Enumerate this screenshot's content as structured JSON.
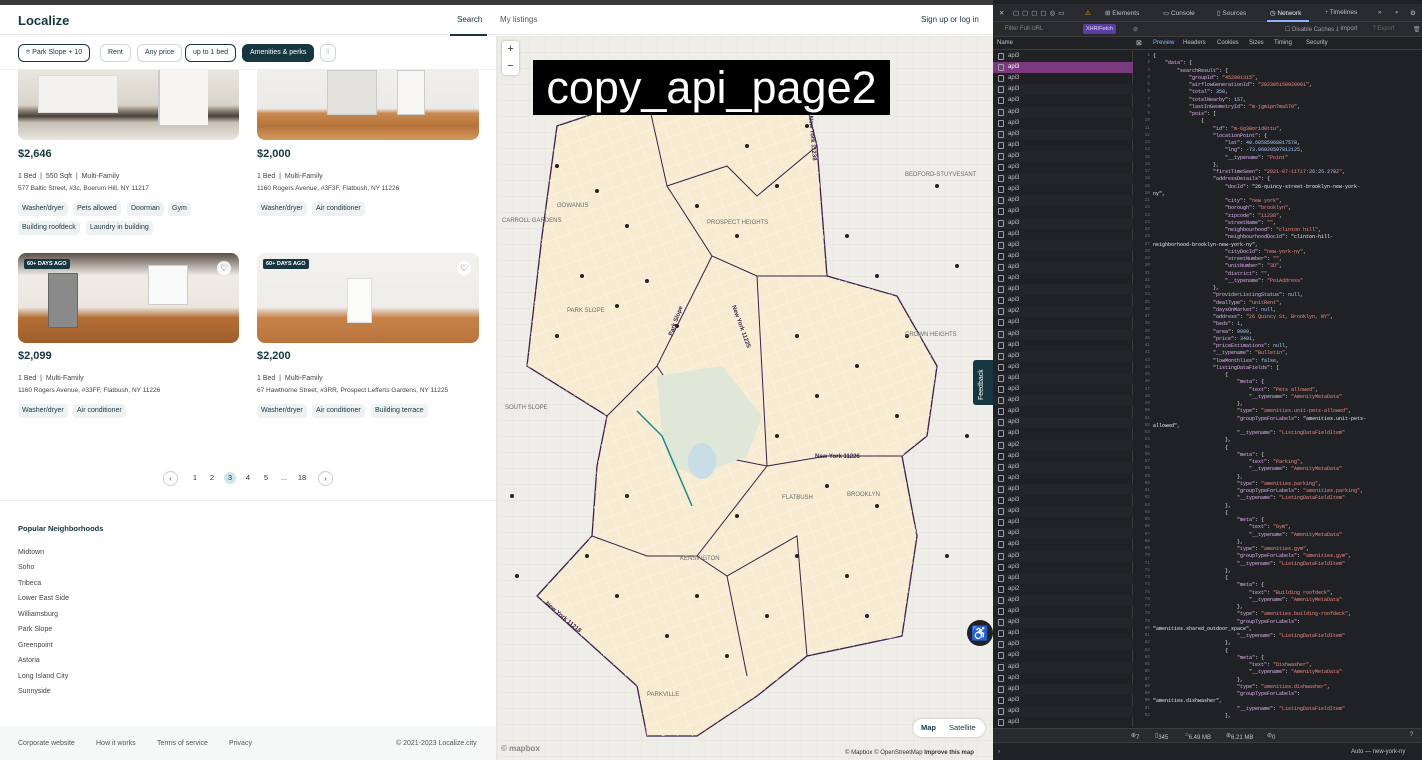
{
  "header": {
    "logo": "Localize",
    "nav_search": "Search",
    "nav_my_listings": "My listings",
    "signup": "Sign up or log in"
  },
  "filters": {
    "location": "Park Slope + 10",
    "deal": "Rent",
    "price": "Any price",
    "beds": "up to 1 bed",
    "amenities": "Amenities & perks",
    "more_icon": "sliders-icon"
  },
  "listings": [
    {
      "price": "$2,646",
      "beds": "1 Bed",
      "sqft": "550 Sqft",
      "type": "Multi-Family",
      "address": "577 Baltic Street, #3c, Boerum Hill, NY 11217",
      "tags": [
        "Washer/dryer",
        "Pets allowed",
        "Doorman",
        "Gym",
        "Building roofdeck",
        "Laundry in building"
      ]
    },
    {
      "price": "$2,000",
      "beds": "1 Bed",
      "type": "Multi-Family",
      "address": "1160 Rogers Avenue, #3F3F, Flatbush, NY 11226",
      "tags": [
        "Washer/dryer",
        "Air conditioner"
      ]
    },
    {
      "badge": "60+ DAYS AGO",
      "price": "$2,099",
      "beds": "1 Bed",
      "type": "Multi-Family",
      "address": "1160 Rogers Avenue, #33FF, Flatbush, NY 11226",
      "tags": [
        "Washer/dryer",
        "Air conditioner"
      ]
    },
    {
      "badge": "60+ DAYS AGO",
      "price": "$2,200",
      "beds": "1 Bed",
      "type": "Multi-Family",
      "address": "67 Hawthorne Street, #3RR, Prospect Lefferts Gardens, NY 11225",
      "tags": [
        "Washer/dryer",
        "Air conditioner",
        "Building terrace"
      ]
    }
  ],
  "pagination": {
    "prev": "‹",
    "pages": [
      "1",
      "2",
      "3",
      "4",
      "5",
      "...",
      "18"
    ],
    "current": "3",
    "next": "›"
  },
  "popular": {
    "title": "Popular Neighborhoods",
    "items": [
      "Midtown",
      "Soho",
      "Tribeca",
      "Lower East Side",
      "Williamsburg",
      "Park Slope",
      "Greenpoint",
      "Astoria",
      "Long Island City",
      "Sunnyside"
    ]
  },
  "footer": {
    "links": [
      "Corporate website",
      "How it works",
      "Terms of service",
      "Privacy"
    ],
    "copyright": "© 2021-2023 Localize.city"
  },
  "map": {
    "zoom_in": "+",
    "zoom_out": "−",
    "overlay_label": "copy_api_page2",
    "feedback": "Feedback",
    "toggle_map": "Map",
    "toggle_satellite": "Satellite",
    "mapbox": "© mapbox",
    "attribution": "© Mapbox © OpenStreetMap",
    "improve": "Improve this map",
    "labels": [
      "GOWANUS",
      "CARROLL GARDENS",
      "PROSPECT HEIGHTS",
      "PARK SLOPE",
      "CROWN HEIGHTS",
      "BEDFORD-STUYVESANT",
      "SOUTH SLOPE",
      "FLATBUSH",
      "BROOKLYN",
      "KENSINGTON",
      "PARKVILLE",
      "New York 11226",
      "New York 11238",
      "New York 11225",
      "Park Slope",
      "New York 11218"
    ]
  },
  "devtools": {
    "tabs": [
      "Elements",
      "Console",
      "Sources",
      "Network",
      "Timelines"
    ],
    "active_tab": "Network",
    "filter_placeholder": "Filter Full URL",
    "xhr_chip": "XHR/Fetch",
    "disable_caches": "Disable Caches",
    "import": "Import",
    "export": "Export",
    "name_col": "Name",
    "subtabs": [
      "Preview",
      "Headers",
      "Cookies",
      "Sizes",
      "Timing",
      "Security"
    ],
    "active_subtab": "Preview",
    "requests": [
      "api3",
      "api3",
      "api3",
      "api3",
      "api3",
      "api3",
      "api3",
      "api3",
      "api3",
      "api3",
      "api3",
      "api3",
      "api3",
      "api3",
      "api3",
      "api3",
      "api3",
      "api3",
      "api3",
      "api3",
      "api3",
      "api3",
      "api3",
      "api2",
      "api3",
      "api3",
      "api3",
      "api3",
      "api3",
      "api3",
      "api3",
      "api3",
      "api3",
      "api3",
      "api3",
      "api2",
      "api3",
      "api3",
      "api3",
      "api3",
      "api3",
      "api3",
      "api3",
      "api3",
      "api3",
      "api3",
      "api3",
      "api3",
      "api2",
      "api3",
      "api3",
      "api3",
      "api3",
      "api3",
      "api3",
      "api3",
      "api3",
      "api3",
      "api3",
      "api3",
      "api3"
    ],
    "selected_index": 1,
    "status": {
      "requests": "7",
      "resources": "345",
      "size": "6.49 MB",
      "transferred": "6.21 MB",
      "time": "0"
    },
    "bottom_right": "Auto — new-york-ny"
  },
  "json_lines": [
    "{",
    "    \"data\": {",
    "        \"searchResult\": {",
    "            \"groupId\": \"452001315\",",
    "            \"airflowGenerationId\": \"202305150920001\",",
    "            \"total\": 350,",
    "            \"totalNearby\": 157,",
    "            \"lastInGeometryId\": \"m-jgmipn7ma570\",",
    "            \"pois\": [",
    "                {",
    "                    \"id\": \"m-6g30orid0ttu\",",
    "                    \"locationPoint\": {",
    "                        \"lat\": 40.68585968017578,",
    "                        \"lng\": -73.96020507812125,",
    "                        \"__typename\": \"Point\"",
    "                    },",
    "                    \"firstTimeSeen\": \"2021-07-11T17:26:25.270Z\",",
    "                    \"addressDetails\": {",
    "                        \"docId\": \"26-quincy-street-brooklyn-new-york-",
    "ny\",",
    "                        \"city\": \"new york\",",
    "                        \"borough\": \"brooklyn\",",
    "                        \"zipcode\": \"11238\",",
    "                        \"streetName\": \"\",",
    "                        \"neighbourhood\": \"clinton hill\",",
    "                        \"neighbourhoodDocId\": \"clinton-hill-",
    "neighborhood-brooklyn-new-york-ny\",",
    "                        \"cityDocId\": \"new-york-ny\",",
    "                        \"streetNumber\": \"\",",
    "                        \"unitNumber\": \"3D\",",
    "                        \"district\": \"\",",
    "                        \"__typename\": \"PoiAddress\"",
    "                    },",
    "                    \"providerListingStatus\": null,",
    "                    \"dealType\": \"unitRent\",",
    "                    \"daysOnMarket\": null,",
    "                    \"address\": \"26 Quincy St, Brooklyn, NY\",",
    "                    \"beds\": 1,",
    "                    \"area\": 9999,",
    "                    \"price\": 3491,",
    "                    \"priceEstimations\": null,",
    "                    \"__typename\": \"Bulletin\",",
    "                    \"lowMonthlies\": false,",
    "                    \"listingDataFields\": [",
    "                        {",
    "                            \"meta\": {",
    "                                \"text\": \"Pets allowed\",",
    "                                \"__typename\": \"AmenityMetaData\"",
    "                            },",
    "                            \"type\": \"amenities.unit-pets-allowed\",",
    "                            \"groupTypeForLabels\": \"amenities.unit-pets-",
    "allowed\",",
    "                            \"__typename\": \"ListingDataFieldItem\"",
    "                        },",
    "                        {",
    "                            \"meta\": {",
    "                                \"text\": \"Parking\",",
    "                                \"__typename\": \"AmenityMetaData\"",
    "                            },",
    "                            \"type\": \"amenities.parking\",",
    "                            \"groupTypeForLabels\": \"amenities.parking\",",
    "                            \"__typename\": \"ListingDataFieldItem\"",
    "                        },",
    "                        {",
    "                            \"meta\": {",
    "                                \"text\": \"Gym\",",
    "                                \"__typename\": \"AmenityMetaData\"",
    "                            },",
    "                            \"type\": \"amenities.gym\",",
    "                            \"groupTypeForLabels\": \"amenities.gym\",",
    "                            \"__typename\": \"ListingDataFieldItem\"",
    "                        },",
    "                        {",
    "                            \"meta\": {",
    "                                \"text\": \"Building roofdeck\",",
    "                                \"__typename\": \"AmenityMetaData\"",
    "                            },",
    "                            \"type\": \"amenities.building-roofdeck\",",
    "                            \"groupTypeForLabels\":",
    "\"amenities.shared_outdoor_space\",",
    "                            \"__typename\": \"ListingDataFieldItem\"",
    "                        },",
    "                        {",
    "                            \"meta\": {",
    "                                \"text\": \"Dishwasher\",",
    "                                \"__typename\": \"AmenityMetaData\"",
    "                            },",
    "                            \"type\": \"amenities.dishwasher\",",
    "                            \"groupTypeForLabels\":",
    "\"amenities.dishwasher\",",
    "                            \"__typename\": \"ListingDataFieldItem\"",
    "                        },"
  ]
}
